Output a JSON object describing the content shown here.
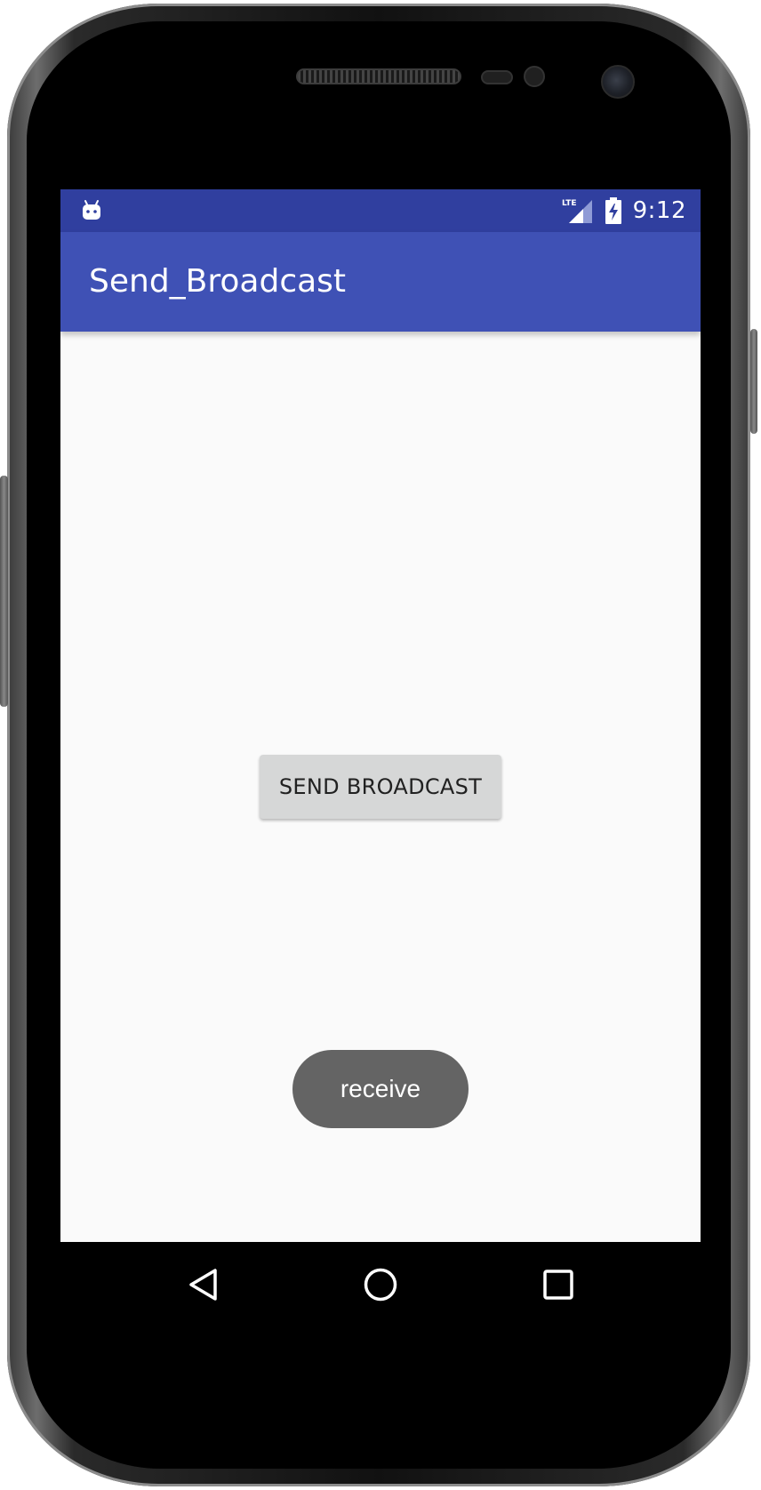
{
  "status_bar": {
    "time": "9:12",
    "network_label": "LTE",
    "icons": [
      "android-debug-icon",
      "lte-signal-icon",
      "battery-charging-icon"
    ]
  },
  "app_bar": {
    "title": "Send_Broadcast"
  },
  "main": {
    "send_button_label": "SEND BROADCAST"
  },
  "toast": {
    "message": "receive"
  },
  "nav_bar": {
    "buttons": [
      "back-icon",
      "home-icon",
      "recents-icon"
    ]
  },
  "colors": {
    "status_bar": "#303f9f",
    "app_bar": "#3f51b5",
    "background": "#fafafa",
    "button": "#d6d7d7",
    "toast": "#646464",
    "nav_bar": "#000000"
  }
}
